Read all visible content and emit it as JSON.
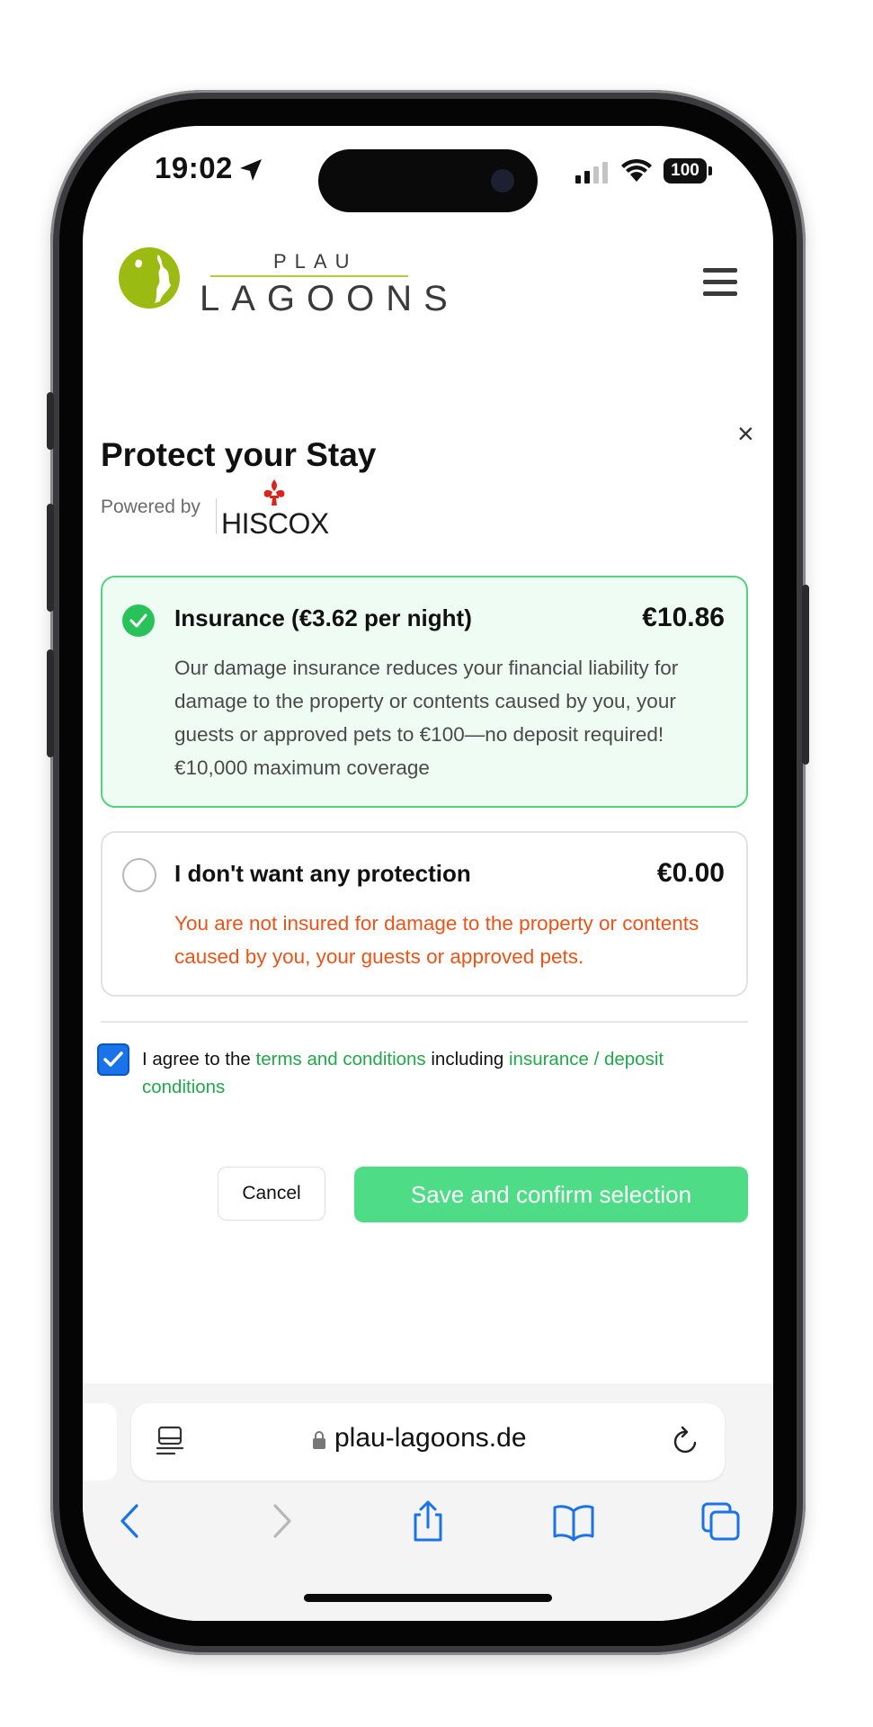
{
  "status_bar": {
    "time": "19:02",
    "battery": "100"
  },
  "site": {
    "logo_top": "PLAU",
    "logo_bottom": "LAGOONS"
  },
  "modal": {
    "title": "Protect your Stay",
    "powered_by": "Powered by",
    "provider": "HISCOX",
    "options": [
      {
        "label": "Insurance (€3.62 per night)",
        "price": "€10.86",
        "description": "Our damage insurance reduces your financial liability for damage to the property or contents caused by you, your guests or approved pets to €100—no deposit required! €10,000 maximum coverage",
        "selected": true
      },
      {
        "label": "I don't want any protection",
        "price": "€0.00",
        "description": "You are not insured for damage to the property or contents caused by you, your guests or approved pets.",
        "selected": false
      }
    ],
    "agree_prefix": "I agree to the",
    "terms_link": "terms and conditions",
    "agree_middle": "including",
    "insurance_link": "insurance / deposit conditions",
    "cancel_label": "Cancel",
    "save_label": "Save and confirm selection"
  },
  "browser": {
    "url": "plau-lagoons.de"
  },
  "colors": {
    "accent_green": "#4fdc86",
    "selected_border": "#54d27c",
    "warning": "#e8541a",
    "link": "#22a84a",
    "ios_blue": "#1a73e8"
  },
  "icons": [
    "location-arrow-icon",
    "signal-icon",
    "wifi-icon",
    "battery-icon",
    "hamburger-menu-icon",
    "close-icon",
    "checkmark-icon",
    "lock-icon",
    "reader-icon",
    "reload-icon",
    "back-icon",
    "forward-icon",
    "share-icon",
    "bookmarks-icon",
    "tabs-icon"
  ]
}
